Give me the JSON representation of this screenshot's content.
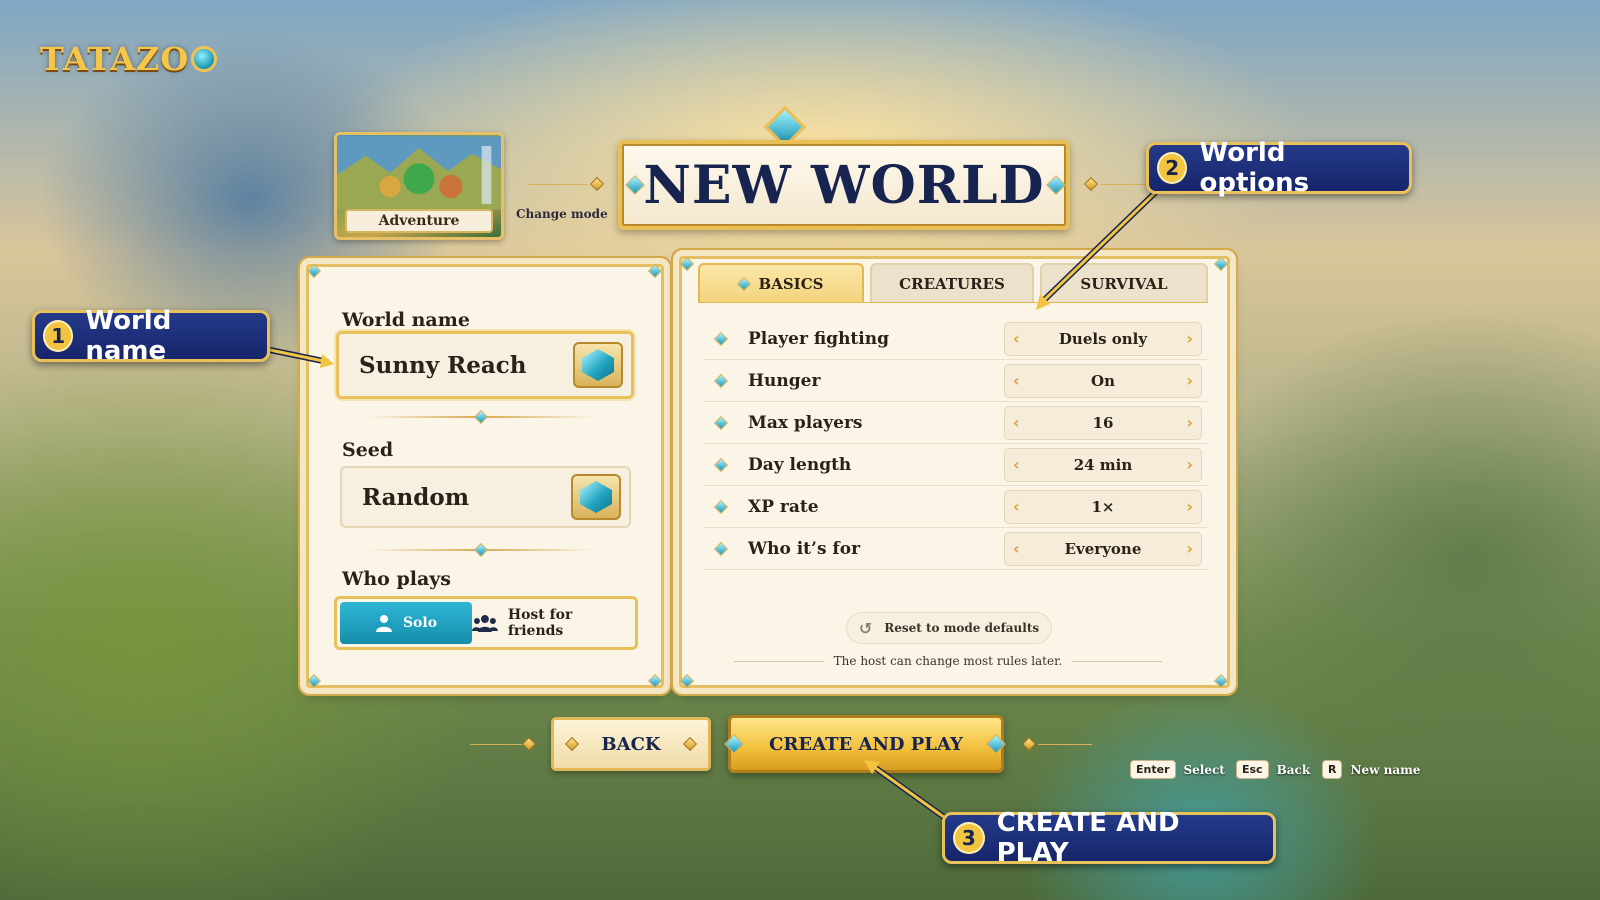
{
  "logo": {
    "text": "TATAZO"
  },
  "mode": {
    "name": "Adventure",
    "change_label": "Change mode"
  },
  "title": "NEW WORLD",
  "left": {
    "world_name_label": "World name",
    "world_name_value": "Sunny Reach",
    "seed_label": "Seed",
    "seed_value": "Random",
    "who_plays_label": "Who plays",
    "who_plays_options": [
      {
        "label": "Solo",
        "icon": "person-icon",
        "selected": true
      },
      {
        "label": "Host for friends",
        "icon": "group-icon",
        "selected": false
      }
    ]
  },
  "tabs": [
    {
      "label": "BASICS",
      "active": true
    },
    {
      "label": "CREATURES",
      "active": false
    },
    {
      "label": "SURVIVAL",
      "active": false
    }
  ],
  "options": [
    {
      "label": "Player fighting",
      "value": "Duels only"
    },
    {
      "label": "Hunger",
      "value": "On"
    },
    {
      "label": "Max players",
      "value": "16"
    },
    {
      "label": "Day length",
      "value": "24 min"
    },
    {
      "label": "XP rate",
      "value": "1×"
    },
    {
      "label": "Who it’s for",
      "value": "Everyone"
    }
  ],
  "reset_label": "Reset to mode defaults",
  "host_note": "The host can change most rules later.",
  "buttons": {
    "back": "BACK",
    "create": "CREATE AND PLAY"
  },
  "hints": [
    {
      "key": "Enter",
      "label": "Select"
    },
    {
      "key": "Esc",
      "label": "Back"
    },
    {
      "key": "R",
      "label": "New name"
    }
  ],
  "callouts": [
    {
      "num": "1",
      "text": "World name"
    },
    {
      "num": "2",
      "text": "World options"
    },
    {
      "num": "3",
      "text": "CREATE AND PLAY"
    }
  ],
  "colors": {
    "accent_gold": "#e8c15a",
    "navy": "#17244f",
    "teal": "#2fb6d6"
  }
}
